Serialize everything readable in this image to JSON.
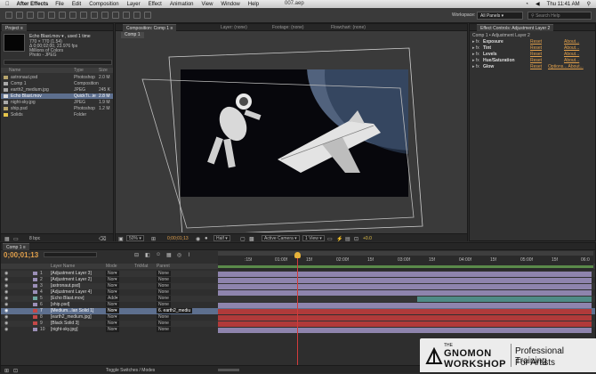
{
  "menubar": {
    "apple": "",
    "app": "After Effects",
    "items": [
      "File",
      "Edit",
      "Composition",
      "Layer",
      "Effect",
      "Animation",
      "View",
      "Window",
      "Help"
    ],
    "doc_title": "007.aep",
    "clock": "Thu 11:41 AM"
  },
  "toolbar": {
    "workspace_label": "Workspace:",
    "workspace_value": "All Panels",
    "search_placeholder": "Search Help"
  },
  "project": {
    "tab": "Project ≡",
    "selected_name": "Echo Blast.mov ▾ , used 1 time",
    "info_lines": [
      "770 × 770 (1.54)",
      "Δ 0;00;02;00, 23.976 fps",
      "Millions of Colors",
      "Photo - JPEG"
    ],
    "col_name": "Name",
    "col_type": "Type",
    "col_size": "Size",
    "items": [
      {
        "name": "astronaut.psd",
        "type": "Photoshop",
        "size": "2.0 M",
        "color": "#b6a46c"
      },
      {
        "name": "Comp 1",
        "type": "Composition",
        "size": "",
        "color": "#a9a9a9"
      },
      {
        "name": "earth2_medium.jpg",
        "type": "JPEG",
        "size": "245 K",
        "color": "#a9a9a9"
      },
      {
        "name": "Echo Blast.mov",
        "type": "QuickTi...ie",
        "size": "2.8 M",
        "color": "#a9a9a9"
      },
      {
        "name": "night-sky.jpg",
        "type": "JPEG",
        "size": "1.9 M",
        "color": "#a9a9a9"
      },
      {
        "name": "ship.psd",
        "type": "Photoshop",
        "size": "1.2 M",
        "color": "#b6a46c"
      },
      {
        "name": "Solids",
        "type": "Folder",
        "size": "",
        "color": "#e6c54a"
      }
    ],
    "bpc": "8 bpc"
  },
  "viewer": {
    "tabs": [
      "Composition: Comp 1 ≡",
      "Layer: (none)",
      "Footage: (none)",
      "Flowchart: (none)"
    ],
    "breadcrumb": "Comp 1",
    "zoom": "50%",
    "timecode": "0;00;01;13",
    "quality": "Half",
    "camera": "Active Camera",
    "views": "1 View",
    "exposure": "+0.0"
  },
  "effects": {
    "tab": "Effect Controls: Adjustment Layer 2",
    "header": "Comp 1 • Adjustment Layer 2",
    "rows": [
      {
        "name": "Exposure",
        "reset": "Reset",
        "about": "About..."
      },
      {
        "name": "Tint",
        "reset": "Reset",
        "about": "About..."
      },
      {
        "name": "Levels",
        "reset": "Reset",
        "about": "About..."
      },
      {
        "name": "Hue/Saturation",
        "reset": "Reset",
        "about": "About..."
      },
      {
        "name": "Glow",
        "reset": "Reset",
        "about": "Options... About..."
      }
    ]
  },
  "timeline": {
    "tab": "Comp 1 ≡",
    "timecode": "0;00;01;13",
    "col_source": "Layer Name",
    "col_mode": "Mode",
    "col_trkmat": "TrkMat",
    "col_parent": "Parent",
    "ruler_ticks": [
      "",
      ":15f",
      "01:00f",
      "15f",
      "02:00f",
      "15f",
      "03:00f",
      "15f",
      "04:00f",
      "15f",
      "05:00f",
      "15f",
      "06:0"
    ],
    "layers": [
      {
        "num": "1",
        "name": "[Adjustment Layer 3]",
        "mode": "Nor▾",
        "parent": "None",
        "swatch": "#9b8fb7",
        "bar": "#8e84ad"
      },
      {
        "num": "2",
        "name": "[Adjustment Layer 2]",
        "mode": "Nor▾",
        "parent": "None",
        "swatch": "#9b8fb7",
        "bar": "#8e84ad"
      },
      {
        "num": "3",
        "name": "[astronaut.psd]",
        "mode": "Nor▾",
        "parent": "None",
        "swatch": "#9b8fb7",
        "bar": "#8e84ad"
      },
      {
        "num": "4",
        "name": "[Adjustment Layer 4]",
        "mode": "Nor▾",
        "parent": "None",
        "swatch": "#9b8fb7",
        "bar": "#8e84ad"
      },
      {
        "num": "5",
        "name": "[Echo Blast.mov]",
        "mode": "Add▾",
        "parent": "None",
        "swatch": "#6fa8a0",
        "bar": "#4f8b86"
      },
      {
        "num": "6",
        "name": "[ship.psd]",
        "mode": "Nor▾",
        "parent": "None",
        "swatch": "#9b8fb7",
        "bar": "#8e84ad"
      },
      {
        "num": "7",
        "name": "[Medium...Ian Solid 1]",
        "mode": "Nor▾",
        "parent": "6. earth2_mediu",
        "swatch": "#c44848",
        "bar": "#b03a3a"
      },
      {
        "num": "8",
        "name": "[earth2_medium.jpg]",
        "mode": "Nor▾",
        "parent": "None",
        "swatch": "#c44848",
        "bar": "#b03a3a"
      },
      {
        "num": "9",
        "name": "[Black Solid 3]",
        "mode": "Nor▾",
        "parent": "None",
        "swatch": "#c44848",
        "bar": "#b03a3a"
      },
      {
        "num": "10",
        "name": "[night-sky.jpg]",
        "mode": "Nor▾",
        "parent": "None",
        "swatch": "#9b8fb7",
        "bar": "#8e84ad"
      }
    ],
    "toggle": "Toggle Switches / Modes"
  },
  "watermark": {
    "the": "THE",
    "brand1": "GNOMON",
    "brand2": "WORKSHOP",
    "line1": "Professional Training",
    "line2": "For Artists"
  }
}
